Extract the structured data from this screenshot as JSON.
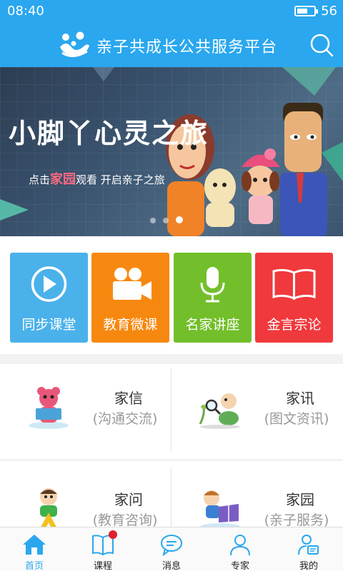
{
  "status": {
    "time": "08:40",
    "battery": "56"
  },
  "header": {
    "title": "亲子共成长公共服务平台",
    "logo_icon": "family-logo-icon",
    "search_icon": "search-icon"
  },
  "banner": {
    "headline": "小脚丫心灵之旅",
    "sub_prefix": "点击",
    "sub_highlight": "家园",
    "sub_suffix": "观看 开启亲子之旅",
    "slide_count": 3,
    "active_slide": 3
  },
  "tiles": [
    {
      "label": "同步课堂",
      "icon": "play-circle-icon",
      "color": "#4ab1ea"
    },
    {
      "label": "教育微课",
      "icon": "video-camera-icon",
      "color": "#f7880f"
    },
    {
      "label": "名家讲座",
      "icon": "microphone-icon",
      "color": "#72bf2b"
    },
    {
      "label": "金言宗论",
      "icon": "open-book-icon",
      "color": "#f0393c"
    }
  ],
  "cards": [
    {
      "name": "家信",
      "desc": "(沟通交流)",
      "icon": "bear-reading-icon"
    },
    {
      "name": "家讯",
      "desc": "(图文资讯)",
      "icon": "child-magnifier-icon"
    },
    {
      "name": "家问",
      "desc": "(教育咨询)",
      "icon": "boy-letter-a-icon"
    },
    {
      "name": "家园",
      "desc": "(亲子服务)",
      "icon": "child-book-icon"
    }
  ],
  "nav": [
    {
      "label": "首页",
      "icon": "home-icon",
      "active": true
    },
    {
      "label": "课程",
      "icon": "book-icon",
      "active": false,
      "badge": true
    },
    {
      "label": "消息",
      "icon": "chat-icon",
      "active": false
    },
    {
      "label": "专家",
      "icon": "person-icon",
      "active": false
    },
    {
      "label": "我的",
      "icon": "profile-card-icon",
      "active": false
    }
  ],
  "colors": {
    "primary": "#2aa7ee",
    "badge": "#e0202a"
  }
}
